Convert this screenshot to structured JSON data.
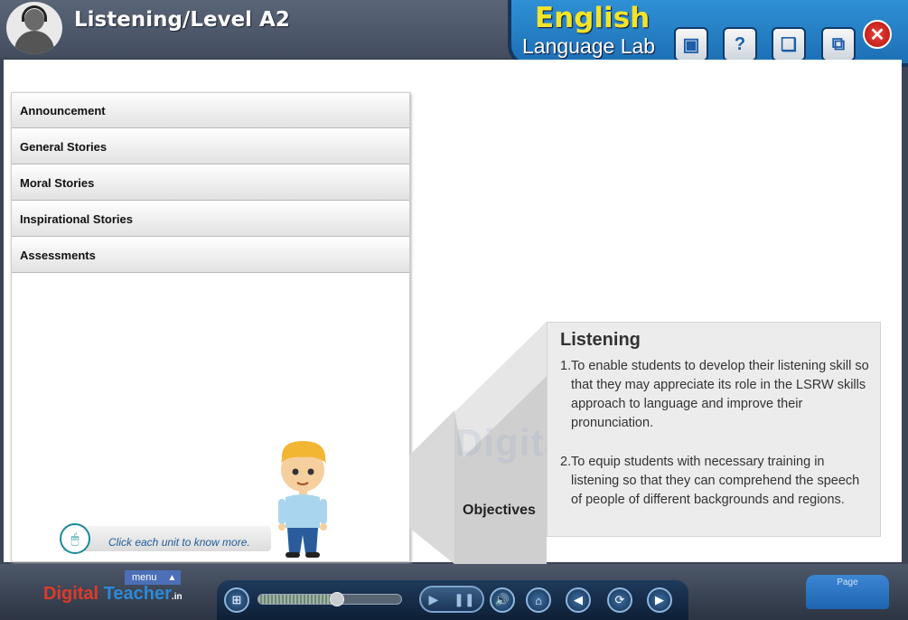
{
  "header": {
    "title": "Listening/Level A2",
    "brand_line1": "English",
    "brand_line2": "Language Lab",
    "tools": [
      {
        "name": "folder-icon",
        "glyph": "▣"
      },
      {
        "name": "help-icon",
        "glyph": "?"
      },
      {
        "name": "book-icon",
        "glyph": "❑"
      },
      {
        "name": "window-icon",
        "glyph": "⧉"
      }
    ],
    "close_glyph": "✕"
  },
  "units": {
    "items": [
      {
        "label": "Announcement"
      },
      {
        "label": "General Stories"
      },
      {
        "label": "Moral Stories"
      },
      {
        "label": "Inspirational Stories"
      },
      {
        "label": "Assessments"
      }
    ],
    "hint": "Click each unit to know more."
  },
  "objectives": {
    "tab_label": "Objectives",
    "title": "Listening",
    "points": [
      {
        "num": "1.",
        "text": "To enable students to develop their listening skill so that they may appreciate its role in the LSRW skills approach to language and improve their pronunciation."
      },
      {
        "num": "2.",
        "text": "To equip students with necessary training in listening so that they can comprehend the speech of people of different backgrounds and regions."
      }
    ],
    "watermark": "Digital Teacher"
  },
  "footer": {
    "logo_part1": "Digital",
    "logo_part2": "Teacher",
    "logo_suffix": ".in",
    "menu_label": "menu",
    "page_label": "Page",
    "progress": 0.55,
    "colors": {
      "accent": "#2d8ad8",
      "brand_yellow": "#f2e42b",
      "close_red": "#d52a20"
    }
  }
}
